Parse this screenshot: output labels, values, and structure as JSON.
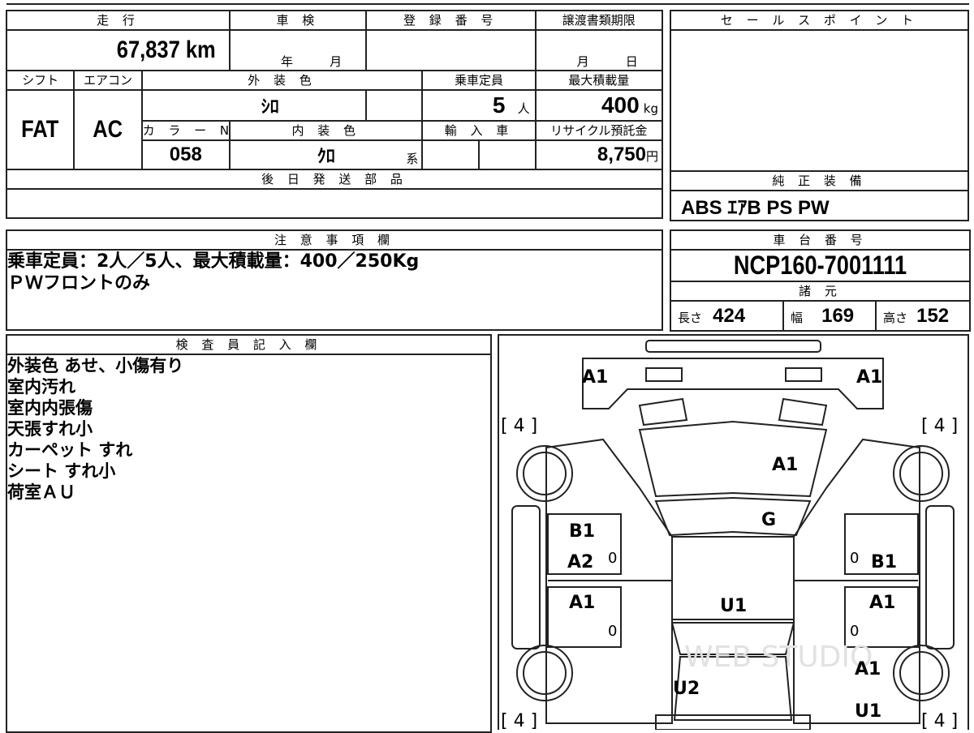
{
  "top": {
    "mileage_header": "走 行",
    "mileage": "67,837 km",
    "inspection_header": "車 検",
    "inspection_year_unit": "年",
    "inspection_month_unit": "月",
    "registration_header": "登 録 番 号",
    "transfer_header": "譲渡書類期限",
    "transfer_month_unit": "月",
    "transfer_day_unit": "日",
    "shift_header": "シフト",
    "shift": "FAT",
    "ac_header": "エアコン",
    "ac": "AC",
    "exterior_header": "外 装 色",
    "exterior_color": "ｼﾛ",
    "capacity_header": "乗車定員",
    "capacity": "5",
    "capacity_unit": "人",
    "max_load_header": "最大積載量",
    "max_load": "400",
    "max_load_unit": "kg",
    "color_no_header": "カ ラ ー No.",
    "color_no": "058",
    "interior_header": "内 装 色",
    "interior_color": "ｸﾛ",
    "interior_suffix": "系",
    "import_header": "輸 入 車",
    "recycle_header": "リサイクル預託金",
    "recycle_fee": "8,750",
    "recycle_unit": "円",
    "later_parts_header": "後 日 発 送 部 品"
  },
  "sales": {
    "header": "セ ー ル ス ポ イ ン ト",
    "genuine_header": "純 正 装 備",
    "genuine_equipment": "ABS ｴｱB PS PW"
  },
  "notes": {
    "header": "注 意 事 項 欄",
    "lines": [
      "乗車定員：2人／5人、最大積載量：400／250Kg",
      "ＰＷフロントのみ"
    ]
  },
  "chassis": {
    "header": "車 台 番 号",
    "number": "NCP160-7001111",
    "specs_header": "諸 元",
    "length_label": "長さ",
    "length": "424",
    "width_label": "幅",
    "width": "169",
    "height_label": "高さ",
    "height": "152"
  },
  "inspector": {
    "header": "検 査 員 記 入 欄",
    "lines": [
      "外装色 あせ、小傷有り",
      "室内汚れ",
      "室内内張傷",
      "天張すれ小",
      "カーペット すれ",
      "シート すれ小",
      "荷室ＡＵ"
    ]
  },
  "diagram": {
    "marks": {
      "front_left": "A1",
      "front_right": "A1",
      "hood": "A1",
      "windshield": "G",
      "roof": "U1",
      "left_front_door_1": "B1",
      "left_front_door_2": "A2",
      "left_rear_door": "A1",
      "right_front_door": "B1",
      "right_rear_door": "A1",
      "rear_right_1": "A1",
      "rear_right_2": "U1",
      "rear_center": "U2"
    },
    "tire_front_left": "[ 4 ]",
    "tire_front_right": "[ 4 ]",
    "tire_rear_left": "[ 4 ]",
    "tire_rear_right": "[ 4 ]",
    "door_zero": "0",
    "watermark": "WEB STUDIO"
  }
}
